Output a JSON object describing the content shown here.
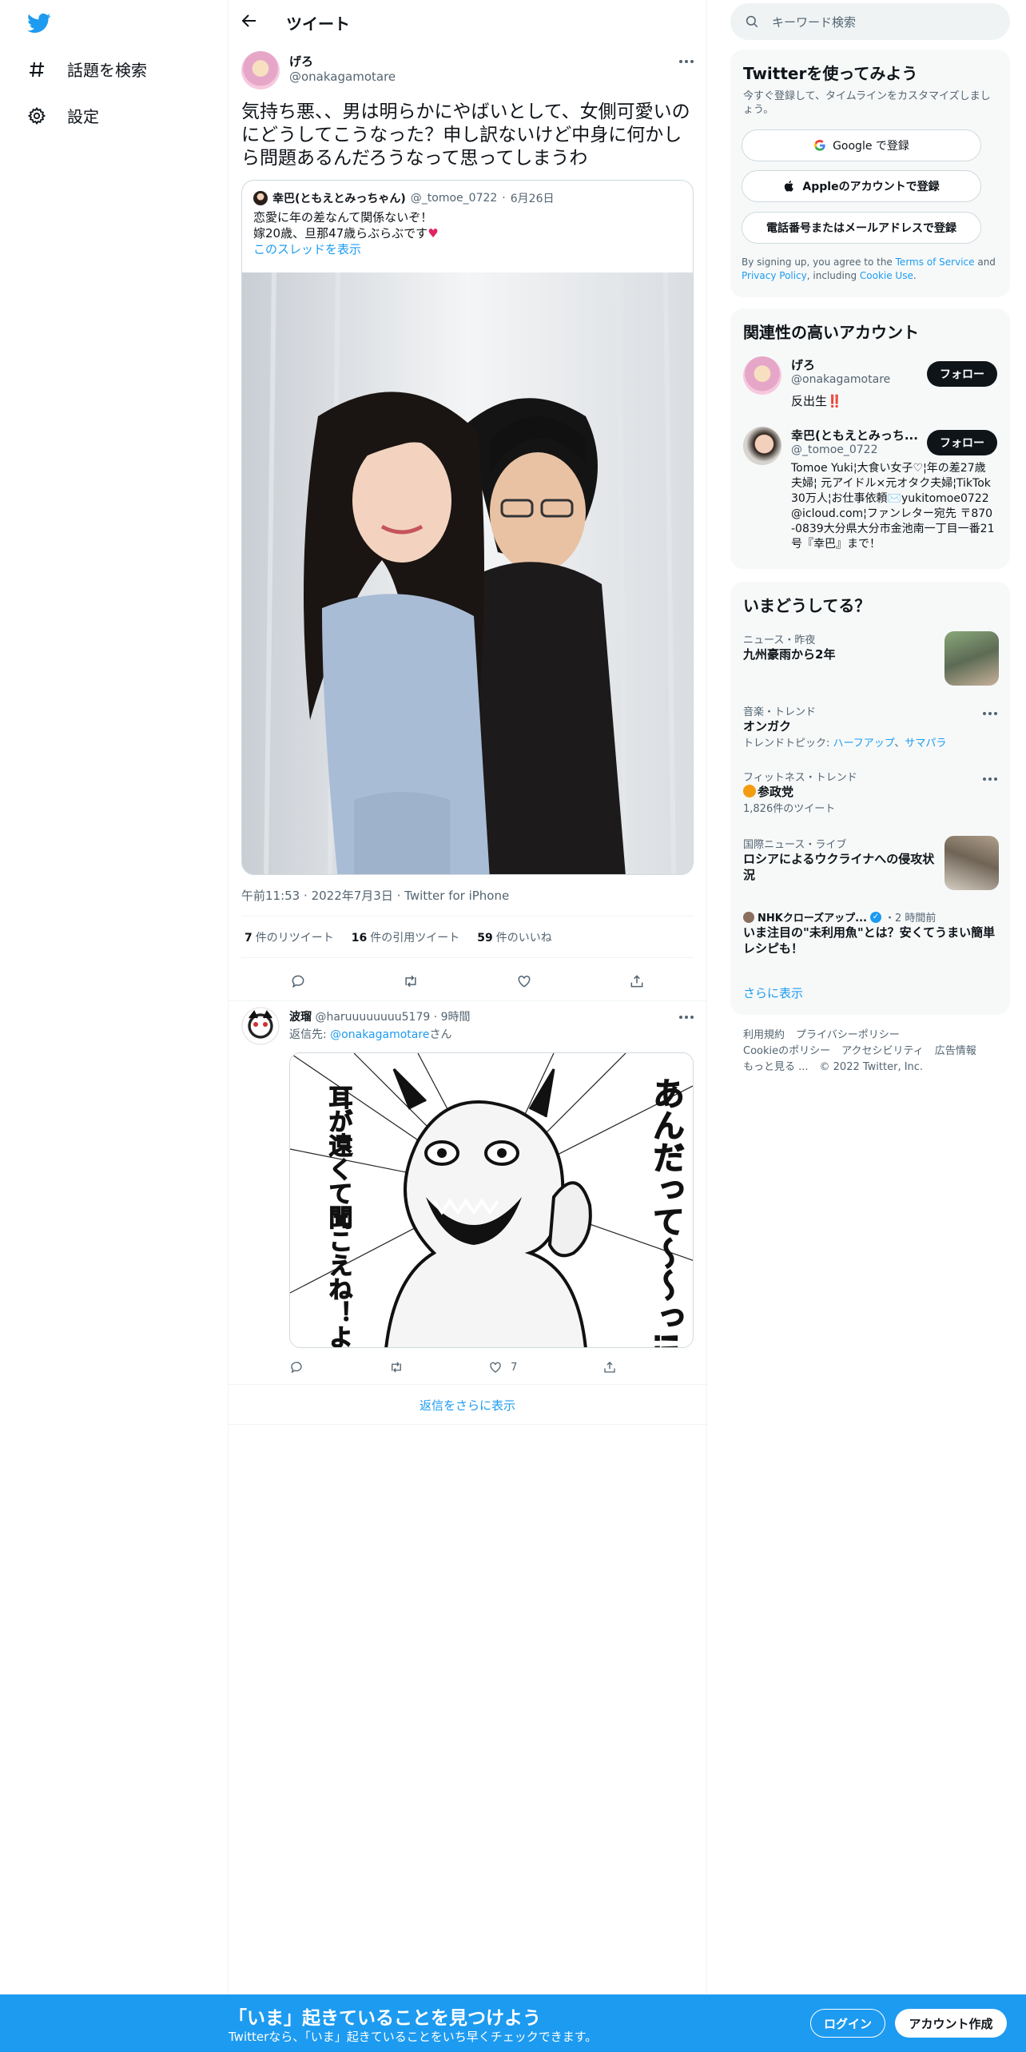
{
  "nav": {
    "items": [
      {
        "label": "話題を検索",
        "icon": "hashtag-icon"
      },
      {
        "label": "設定",
        "icon": "gear-icon"
      }
    ]
  },
  "header": {
    "title": "ツイート"
  },
  "tweet": {
    "name": "げろ",
    "handle": "@onakagamotare",
    "text": "気持ち悪、、男は明らかにやばいとして、女側可愛いのにどうしてこうなった？申し訳ないけど中身に何かしら問題あるんだろうなって思ってしまうわ",
    "quote": {
      "name": "幸巴(ともえとみっちゃん)",
      "handle": "@_tomoe_0722",
      "date": "6月26日",
      "line1": "恋愛に年の差なんて関係ないぞ！",
      "line2": "嫁20歳、旦那47歳らぶらぶです",
      "heart": "♥",
      "thread_link": "このスレッドを表示"
    },
    "meta": {
      "time": "午前11:53",
      "date": "2022年7月3日",
      "source": "Twitter for iPhone"
    },
    "stats": {
      "retweets": "7",
      "retweets_label": "件のリツイート",
      "quotes": "16",
      "quotes_label": "件の引用ツイート",
      "likes": "59",
      "likes_label": "件のいいね"
    }
  },
  "reply": {
    "name": "波瑠",
    "handle": "@haruuuuuuuu5179",
    "time": "9時間",
    "reply_to_prefix": "返信先: ",
    "reply_to_handle": "@onakagamotare",
    "reply_to_suffix": "さん",
    "manga_text_1": "あんだって〜〜っ!!?",
    "manga_text_2": "耳が遠くて聞こえね！よ！!!",
    "like_count": "7"
  },
  "show_more_replies": "返信をさらに表示",
  "search": {
    "placeholder": "キーワード検索"
  },
  "signup_card": {
    "title": "Twitterを使ってみよう",
    "subtitle": "今すぐ登録して、タイムラインをカスタマイズしましょう。",
    "google": "Google で登録",
    "apple": "Appleのアカウントで登録",
    "phone": "電話番号またはメールアドレスで登録",
    "legal_1": "By signing up, you agree to the ",
    "legal_tos": "Terms of Service",
    "legal_2": " and ",
    "legal_pp": "Privacy Policy",
    "legal_3": ", including ",
    "legal_cookie": "Cookie Use",
    "legal_4": "."
  },
  "related": {
    "title": "関連性の高いアカウント",
    "follow_label": "フォロー",
    "accounts": [
      {
        "name": "げろ",
        "handle": "@onakagamotare",
        "bio": "反出生‼️"
      },
      {
        "name": "幸巴(ともえとみっち...",
        "handle": "@_tomoe_0722",
        "bio": "Tomoe Yuki¦大食い女子♡¦年の差27歳夫婦¦ 元アイドル×元オタク夫婦¦TikTok30万人¦お仕事依頼✉️yukitomoe0722@icloud.com¦ファンレター宛先 〒870-0839大分県大分市金池南一丁目一番21号『幸巴』まで！"
      }
    ]
  },
  "trends": {
    "title": "いまどうしてる？",
    "items": [
      {
        "category": "ニュース・昨夜",
        "title": "九州豪雨から2年"
      },
      {
        "category": "音楽・トレンド",
        "title": "オンガク",
        "sub_prefix": "トレンドトピック: ",
        "sub_link1": "ハーフアップ",
        "sub_sep": "、",
        "sub_link2": "サマパラ"
      },
      {
        "category": "フィットネス・トレンド",
        "title": "参政党",
        "sub": "1,826件のツイート"
      },
      {
        "category": "国際ニュース・ライブ",
        "title": "ロシアによるウクライナへの侵攻状況"
      },
      {
        "source": "NHKクローズアップ...",
        "time": "・2 時間前",
        "title": "いま注目の\"未利用魚\"とは？安くてうまい簡単レシピも！"
      }
    ],
    "show_more": "さらに表示"
  },
  "footer": {
    "links": [
      "利用規約",
      "プライバシーポリシー",
      "Cookieのポリシー",
      "アクセシビリティ",
      "広告情報",
      "もっと見る ..."
    ],
    "copyright": "© 2022 Twitter, Inc."
  },
  "bottom_bar": {
    "title": "「いま」起きていることを見つけよう",
    "subtitle": "Twitterなら、「いま」起きていることをいち早くチェックできます。",
    "login": "ログイン",
    "signup": "アカウント作成"
  },
  "colors": {
    "accent": "#1d9bf0",
    "text": "#0f1419",
    "muted": "#536471",
    "border": "#eff3f4"
  }
}
